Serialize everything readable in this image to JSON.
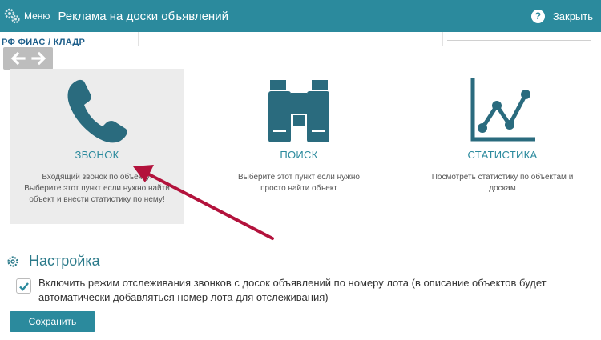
{
  "topbar": {
    "menu_label": "Меню",
    "title": "Реклама на доски объявлений",
    "close_label": "Закрыть",
    "help_glyph": "?"
  },
  "background": {
    "fragment_text": "РФ ФИАС / КЛАДР"
  },
  "cards": [
    {
      "title": "ЗВОНОК",
      "desc_lines": [
        "Входящий звонок по объекту!",
        "Выберите этот пункт если нужно найти",
        "объект и внести статистику по нему!"
      ],
      "icon": "phone-icon",
      "active": true
    },
    {
      "title": "ПОИСК",
      "desc_lines": [
        "Выберите этот пункт если нужно",
        "просто найти объект"
      ],
      "icon": "binoculars-icon",
      "active": false
    },
    {
      "title": "СТАТИСТИКА",
      "desc_lines": [
        "Посмотреть статистику по объектам и",
        "доскам"
      ],
      "icon": "chart-icon",
      "active": false
    }
  ],
  "settings": {
    "title": "Настройка",
    "checkbox_checked": true,
    "checkbox_label": "Включить режим отслеживания звонков с досок объявлений по номеру лота (в описание объектов будет автоматически добавляться номер лота для отслеживания)",
    "save_label": "Сохранить"
  },
  "colors": {
    "accent": "#2b8a9d",
    "icon_dark": "#2a6b7e",
    "annotation_arrow": "#b3123c"
  }
}
